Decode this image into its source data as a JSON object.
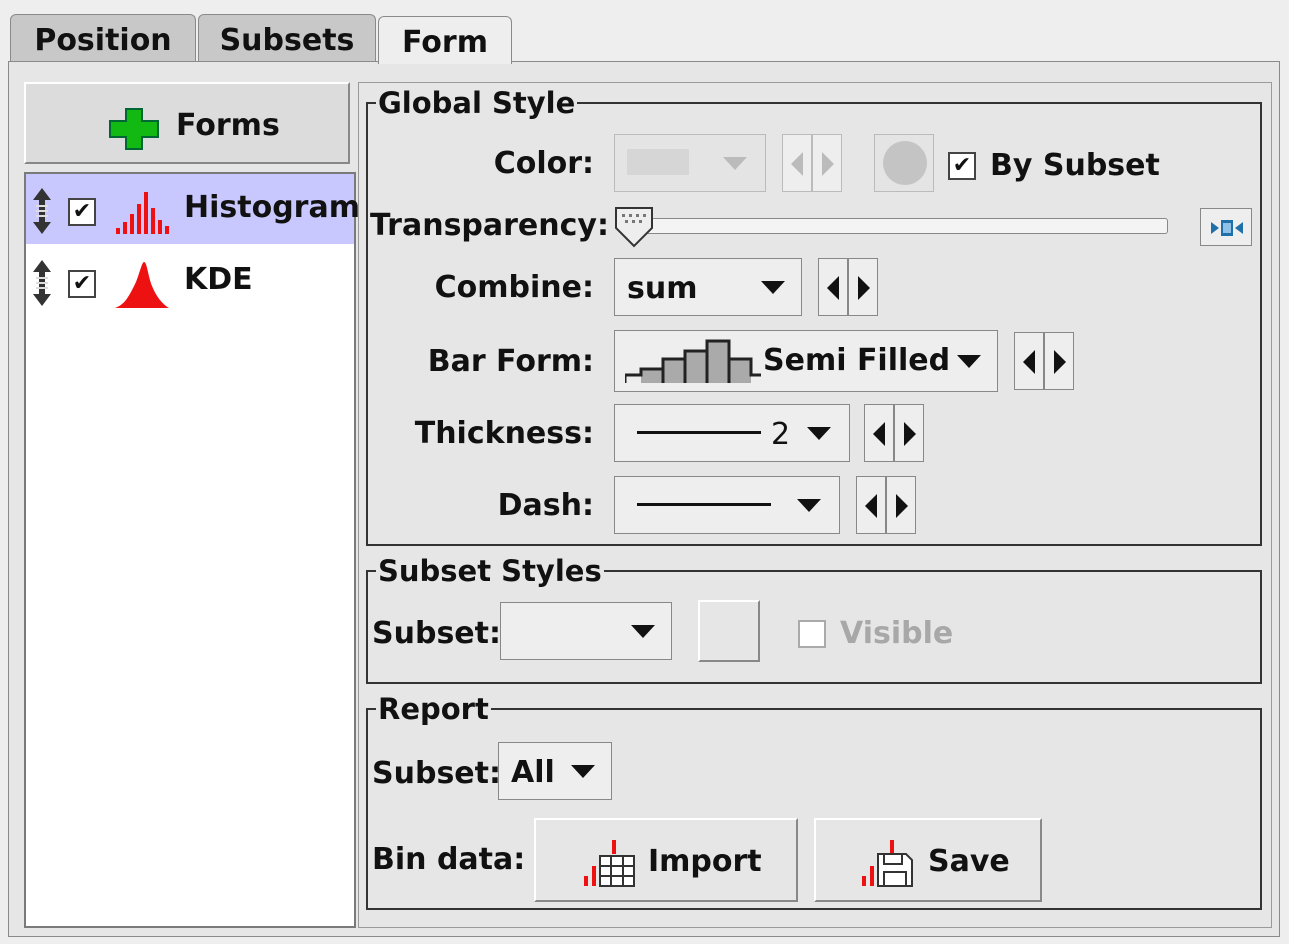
{
  "tabs": [
    {
      "label": "Position",
      "active": false
    },
    {
      "label": "Subsets",
      "active": false
    },
    {
      "label": "Form",
      "active": true
    }
  ],
  "left_panel": {
    "forms_button_label": "Forms",
    "forms_button_icon": "plus-icon",
    "items": [
      {
        "label": "Histogram",
        "checked": true,
        "selected": true,
        "icon": "histogram-icon"
      },
      {
        "label": "KDE",
        "checked": true,
        "selected": false,
        "icon": "kde-icon"
      }
    ]
  },
  "global_style": {
    "title": "Global Style",
    "color_label": "Color:",
    "by_subset_label": "By Subset",
    "by_subset_checked": true,
    "transparency_label": "Transparency:",
    "transparency_value": 0,
    "combine_label": "Combine:",
    "combine_value": "sum",
    "bar_form_label": "Bar Form:",
    "bar_form_value": "Semi Filled",
    "thickness_label": "Thickness:",
    "thickness_value": "2",
    "dash_label": "Dash:"
  },
  "subset_styles": {
    "title": "Subset Styles",
    "subset_label": "Subset:",
    "subset_value": "",
    "visible_label": "Visible",
    "visible_checked": false
  },
  "report": {
    "title": "Report",
    "subset_label": "Subset:",
    "subset_value": "All",
    "bin_data_label": "Bin data:",
    "import_label": "Import",
    "save_label": "Save"
  },
  "colors": {
    "selected_row": "#c8c8ff",
    "icon_red": "#ee1111",
    "plus_green": "#13b913",
    "dock_blue": "#1f6fa8"
  }
}
